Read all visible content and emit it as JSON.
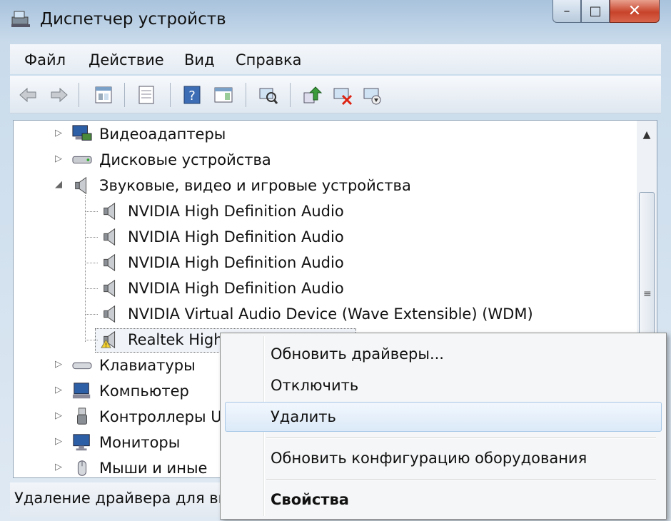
{
  "window": {
    "title": "Диспетчер устройств"
  },
  "caption_buttons": {
    "minimize": "–",
    "maximize": "□",
    "close": "✕"
  },
  "menu": [
    "Файл",
    "Действие",
    "Вид",
    "Справка"
  ],
  "toolbar": [
    "back-icon",
    "forward-icon",
    "properties-sheet-icon",
    "show-hidden-icon",
    "help-icon",
    "action-pane-icon",
    "scan-hardware-icon",
    "update-driver-icon",
    "disable-device-icon",
    "uninstall-device-icon"
  ],
  "tree": {
    "rows": [
      {
        "label": "Видеоадаптеры",
        "expander": "▷",
        "icon": "display-adapter-icon"
      },
      {
        "label": "Дисковые устройства",
        "expander": "▷",
        "icon": "disk-drive-icon"
      },
      {
        "label": "Звуковые, видео и игровые устройства",
        "expander": "◢",
        "icon": "speaker-icon"
      },
      {
        "label": "NVIDIA High Definition Audio",
        "icon": "speaker-icon"
      },
      {
        "label": "NVIDIA High Definition Audio",
        "icon": "speaker-icon"
      },
      {
        "label": "NVIDIA High Definition Audio",
        "icon": "speaker-icon"
      },
      {
        "label": "NVIDIA High Definition Audio",
        "icon": "speaker-icon"
      },
      {
        "label": "NVIDIA Virtual Audio Device (Wave Extensible) (WDM)",
        "icon": "speaker-icon"
      },
      {
        "label": "Realtek High",
        "icon": "warning-speaker-icon"
      },
      {
        "label": "Клавиатуры",
        "expander": "▷",
        "icon": "keyboard-icon"
      },
      {
        "label": "Компьютер",
        "expander": "▷",
        "icon": "computer-icon"
      },
      {
        "label": "Контроллеры U",
        "expander": "▷",
        "icon": "usb-icon"
      },
      {
        "label": "Мониторы",
        "expander": "▷",
        "icon": "monitor-icon"
      },
      {
        "label": "Мыши и иные",
        "expander": "▷",
        "icon": "mouse-icon"
      }
    ]
  },
  "status": {
    "text": "Удаление драйвера для вы"
  },
  "context_menu": {
    "items": [
      "Обновить драйверы...",
      "Отключить",
      "Удалить",
      "Обновить конфигурацию оборудования",
      "Свойства"
    ]
  }
}
